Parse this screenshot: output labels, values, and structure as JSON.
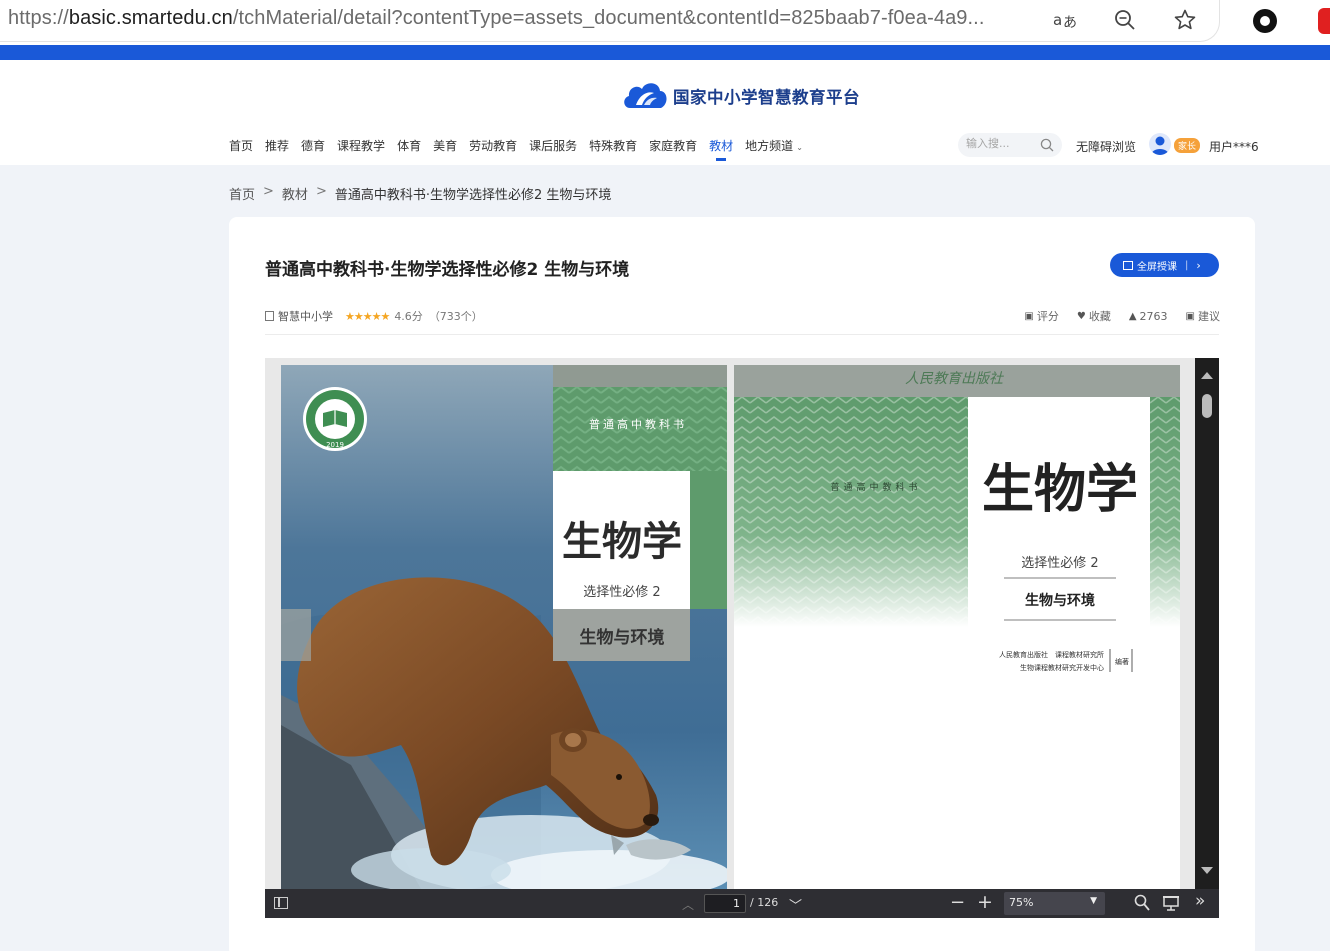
{
  "browser": {
    "url_prefix": "https://",
    "url_host": "basic.smartedu.cn",
    "url_rest": "/tchMaterial/detail?contentType=assets_document&contentId=825baab7-f0ea-4a9..."
  },
  "site": {
    "logo_text": "国家中小学智慧教育平台",
    "nav": [
      {
        "label": "首页"
      },
      {
        "label": "推荐"
      },
      {
        "label": "德育"
      },
      {
        "label": "课程教学"
      },
      {
        "label": "体育"
      },
      {
        "label": "美育"
      },
      {
        "label": "劳动教育"
      },
      {
        "label": "课后服务"
      },
      {
        "label": "特殊教育"
      },
      {
        "label": "家庭教育"
      },
      {
        "label": "教材",
        "active": true
      },
      {
        "label": "地方频道"
      }
    ],
    "search_placeholder": "输入搜...",
    "accessibility": "无障碍浏览",
    "role_badge": "家长",
    "username": "用户***6"
  },
  "breadcrumb": [
    "首页",
    "教材",
    "普通高中教科书·生物学选择性必修2 生物与环境"
  ],
  "breadcrumb_sep": ">",
  "detail": {
    "title": "普通高中教科书·生物学选择性必修2 生物与环境",
    "fullscreen_label": "全屏授课",
    "publisher": "智慧中小学",
    "stars": "★★★★★",
    "rating": "4.6分",
    "rating_count": "（733个）",
    "actions": {
      "rate": "评分",
      "favorite": "收藏",
      "likes": "2763",
      "suggest": "建议"
    }
  },
  "cover": {
    "series": "普通高中教科书",
    "subject": "生物学",
    "volume": "选择性必修 2",
    "book_title": "生物与环境",
    "badge_year": "2019",
    "publisher_script": "人民教育出版社",
    "editors_line1": "人民教育出版社　课程教材研究所",
    "editors_line2": "生物课程教材研究开发中心",
    "editors_role": "编著"
  },
  "viewer": {
    "page_current": "1",
    "page_total": "/ 126",
    "zoom": "75%"
  },
  "colors": {
    "brand_blue": "#1a59d8",
    "cover_green": "#5e9b6c",
    "stars": "#f5a623"
  }
}
